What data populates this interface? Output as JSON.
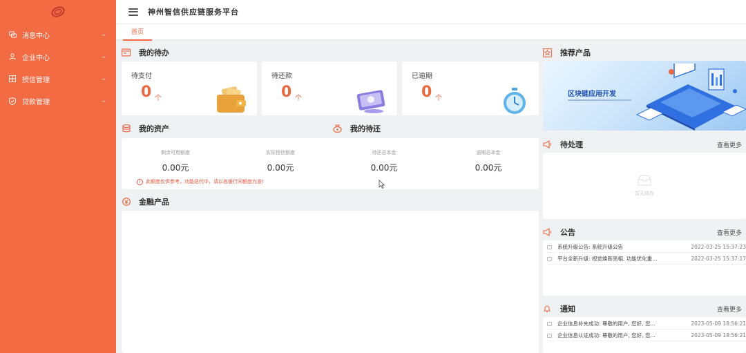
{
  "header": {
    "title": "神州智信供应链服务平台"
  },
  "tabs": [
    {
      "label": "首页"
    }
  ],
  "sidebar": {
    "items": [
      {
        "label": "消息中心",
        "icon": "message-icon"
      },
      {
        "label": "企业中心",
        "icon": "user-icon"
      },
      {
        "label": "授信管理",
        "icon": "grid-icon"
      },
      {
        "label": "贷款管理",
        "icon": "shield-icon"
      }
    ]
  },
  "todo": {
    "title": "我的待办",
    "items": [
      {
        "label": "待支付",
        "value": "0",
        "unit": "个"
      },
      {
        "label": "待还款",
        "value": "0",
        "unit": "个"
      },
      {
        "label": "已逾期",
        "value": "0",
        "unit": "个"
      }
    ]
  },
  "assets": {
    "title": "我的资产",
    "title2": "我的待还",
    "items": [
      {
        "label": "剩余可用额度",
        "value": "0.00元"
      },
      {
        "label": "实际授信额度",
        "value": "0.00元"
      },
      {
        "label": "待还总本金",
        "value": "0.00元"
      },
      {
        "label": "逾期总本金",
        "value": "0.00元"
      }
    ],
    "notice": "此额度仅供参考，功能迭代中，请以各银行间额度为准!"
  },
  "finance": {
    "title": "金融产品"
  },
  "recommend": {
    "title": "推荐产品",
    "banner_text": "区块链应用开发"
  },
  "pending": {
    "title": "待处理",
    "more": "查看更多",
    "empty_text": "暂无待办"
  },
  "announcements": {
    "title": "公告",
    "more": "查看更多",
    "items": [
      {
        "text": "系统升级公告: 系统升级公告",
        "time": "2022-03-25 15:37:23"
      },
      {
        "text": "平台全新升级: 视觉焕新亮相, 功能优化重...",
        "time": "2022-03-25 15:37:17"
      }
    ]
  },
  "notifications": {
    "title": "通知",
    "more": "查看更多",
    "items": [
      {
        "text": "企业信息补充成功: 尊敬的用户, 您好, 您...",
        "time": "2023-05-09 18:56:21"
      },
      {
        "text": "企业信息认证成功: 尊敬的用户, 您好, 您...",
        "time": "2023-05-09 18:56:21"
      }
    ]
  },
  "colors": {
    "accent": "#f26b43",
    "value": "#e86a43",
    "background": "#f0f1f3"
  }
}
